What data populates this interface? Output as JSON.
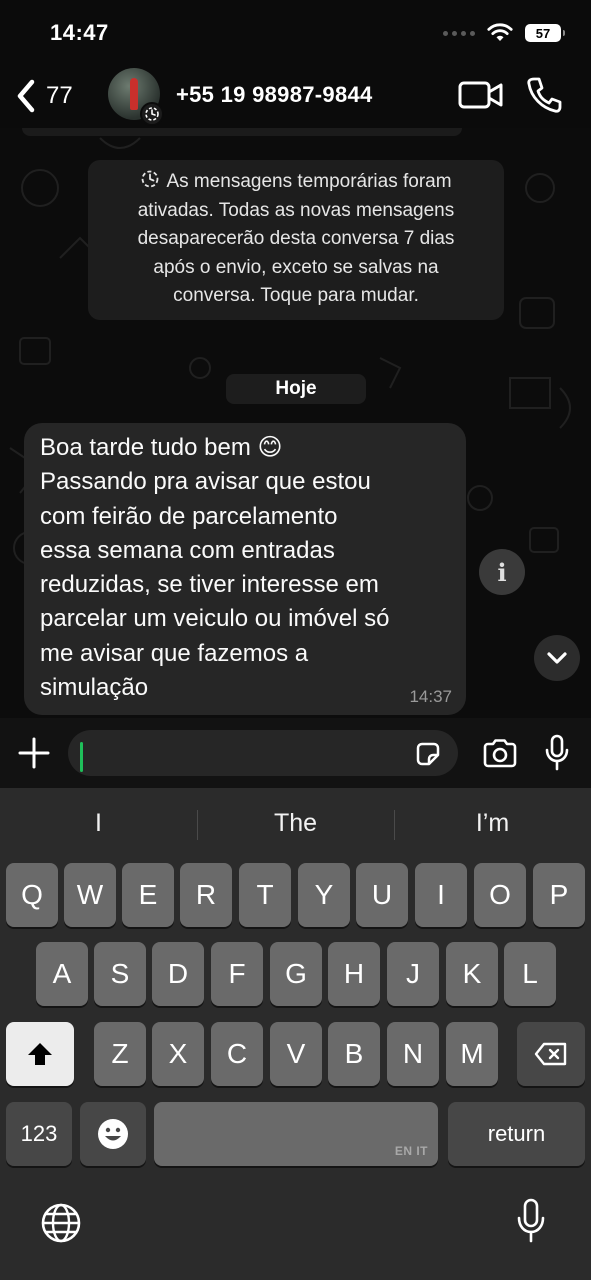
{
  "status_bar": {
    "time": "14:47",
    "battery": "57"
  },
  "header": {
    "back_count": "77",
    "contact_name": "+55 19 98987-9844"
  },
  "chat": {
    "system_message": "As mensagens temporárias foram\nativadas. Todas as novas mensagens\ndesaparecerão desta conversa 7 dias\napós o envio, exceto se salvas na\nconversa. Toque para mudar.",
    "date_label": "Hoje",
    "messages": [
      {
        "text": "Boa tarde tudo bem 😊\nPassando pra avisar que estou\ncom feirão de parcelamento\nessa semana com entradas\nreduzidas, se tiver interesse em\nparcelar um veiculo ou imóvel só\nme avisar que fazemos a\nsimulação",
        "time": "14:37"
      }
    ],
    "info_label": "i"
  },
  "input": {
    "placeholder": ""
  },
  "keyboard": {
    "suggestions": [
      "I",
      "The",
      "I’m"
    ],
    "row1": [
      "Q",
      "W",
      "E",
      "R",
      "T",
      "Y",
      "U",
      "I",
      "O",
      "P"
    ],
    "row2": [
      "A",
      "S",
      "D",
      "F",
      "G",
      "H",
      "J",
      "K",
      "L"
    ],
    "row3": [
      "Z",
      "X",
      "C",
      "V",
      "B",
      "N",
      "M"
    ],
    "numbers_label": "123",
    "space_language": "EN IT",
    "return_label": "return"
  },
  "colors": {
    "background": "#0c0c0c",
    "bubble": "#262626",
    "caret": "#1fbf5a",
    "keyboard": "#2b2b2b",
    "key": "#6a6a6a"
  },
  "icons": [
    "back-chevron-icon",
    "timer-icon",
    "video-camera-icon",
    "phone-icon",
    "info-icon",
    "chevron-down-icon",
    "plus-icon",
    "sticker-icon",
    "camera-icon",
    "microphone-icon",
    "shift-icon",
    "delete-icon",
    "emoji-icon",
    "globe-icon",
    "dictation-icon",
    "wifi-icon"
  ]
}
